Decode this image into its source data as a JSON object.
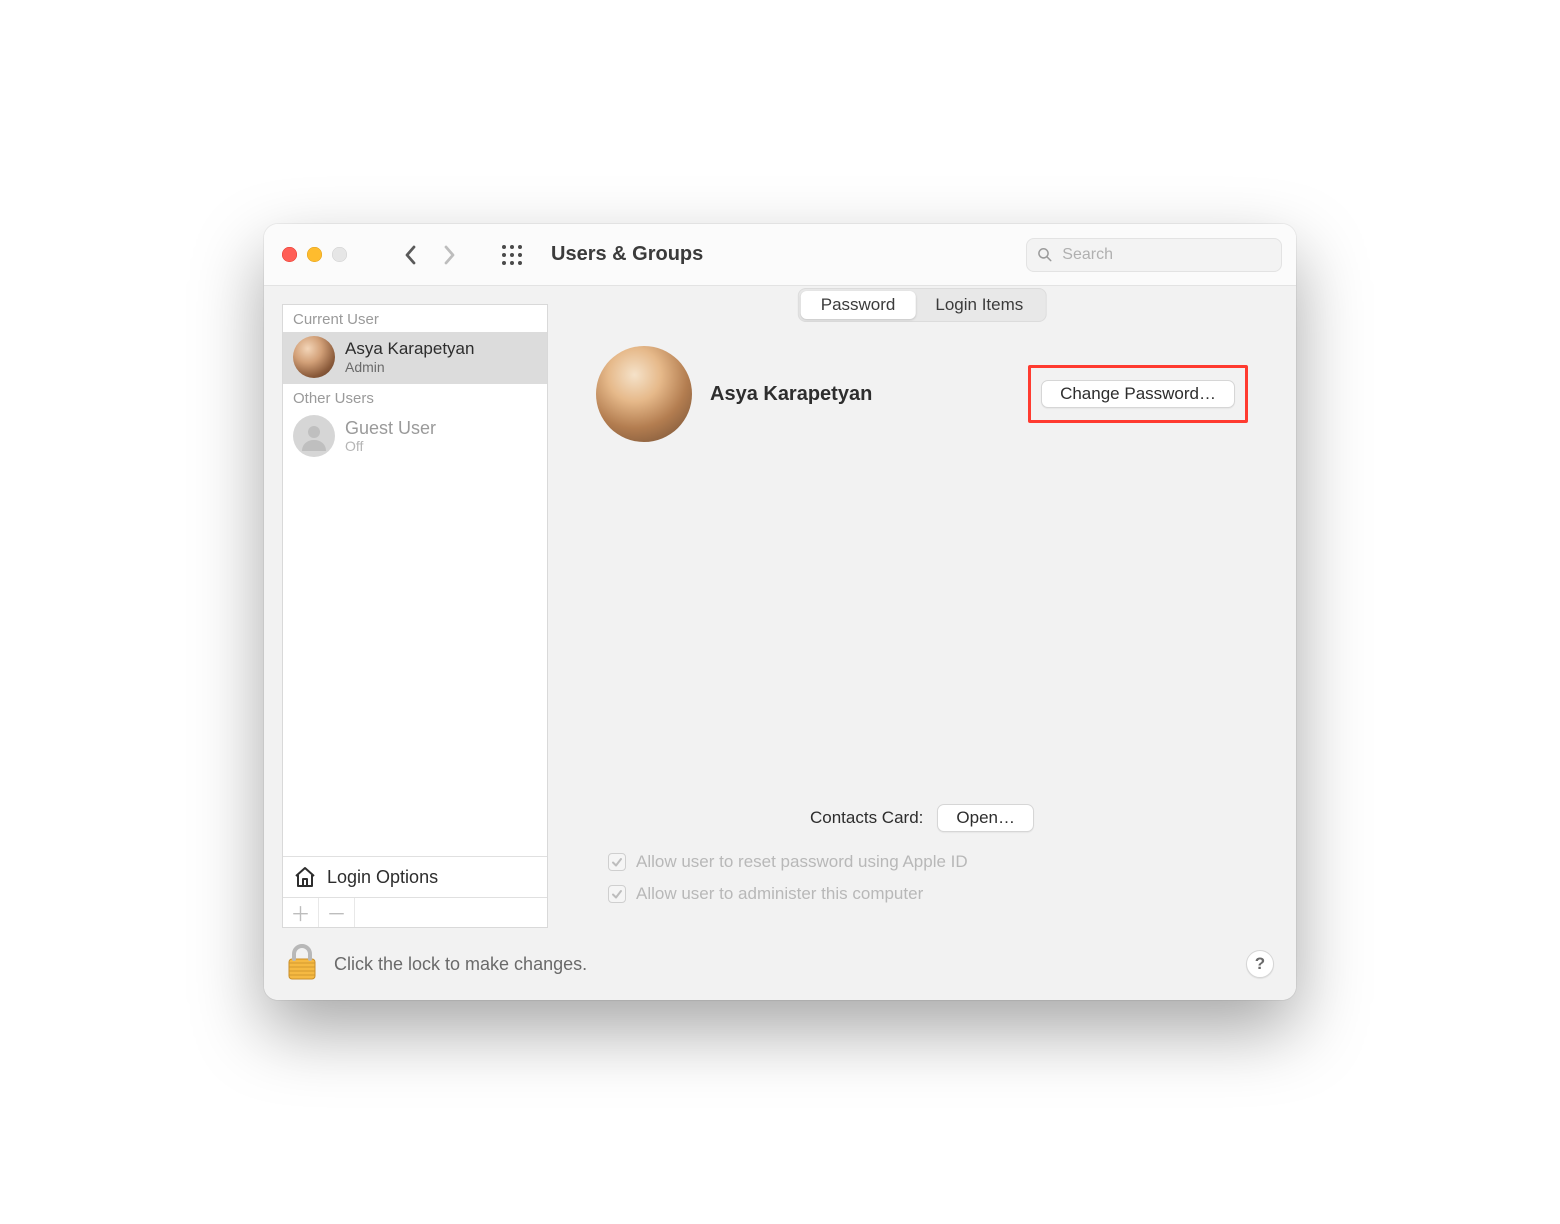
{
  "window": {
    "title": "Users & Groups"
  },
  "search": {
    "placeholder": "Search"
  },
  "sidebar": {
    "current_label": "Current User",
    "other_label": "Other Users",
    "current": {
      "name": "Asya Karapetyan",
      "role": "Admin"
    },
    "other": [
      {
        "name": "Guest User",
        "role": "Off"
      }
    ],
    "login_options": "Login Options"
  },
  "tabs": {
    "password": "Password",
    "login_items": "Login Items",
    "active": "password"
  },
  "hero": {
    "name": "Asya Karapetyan",
    "change_password": "Change Password…"
  },
  "contacts": {
    "label": "Contacts Card:",
    "open": "Open…"
  },
  "checks": {
    "reset": "Allow user to reset password using Apple ID",
    "admin": "Allow user to administer this computer"
  },
  "footer": {
    "lock_text": "Click the lock to make changes.",
    "help": "?"
  }
}
